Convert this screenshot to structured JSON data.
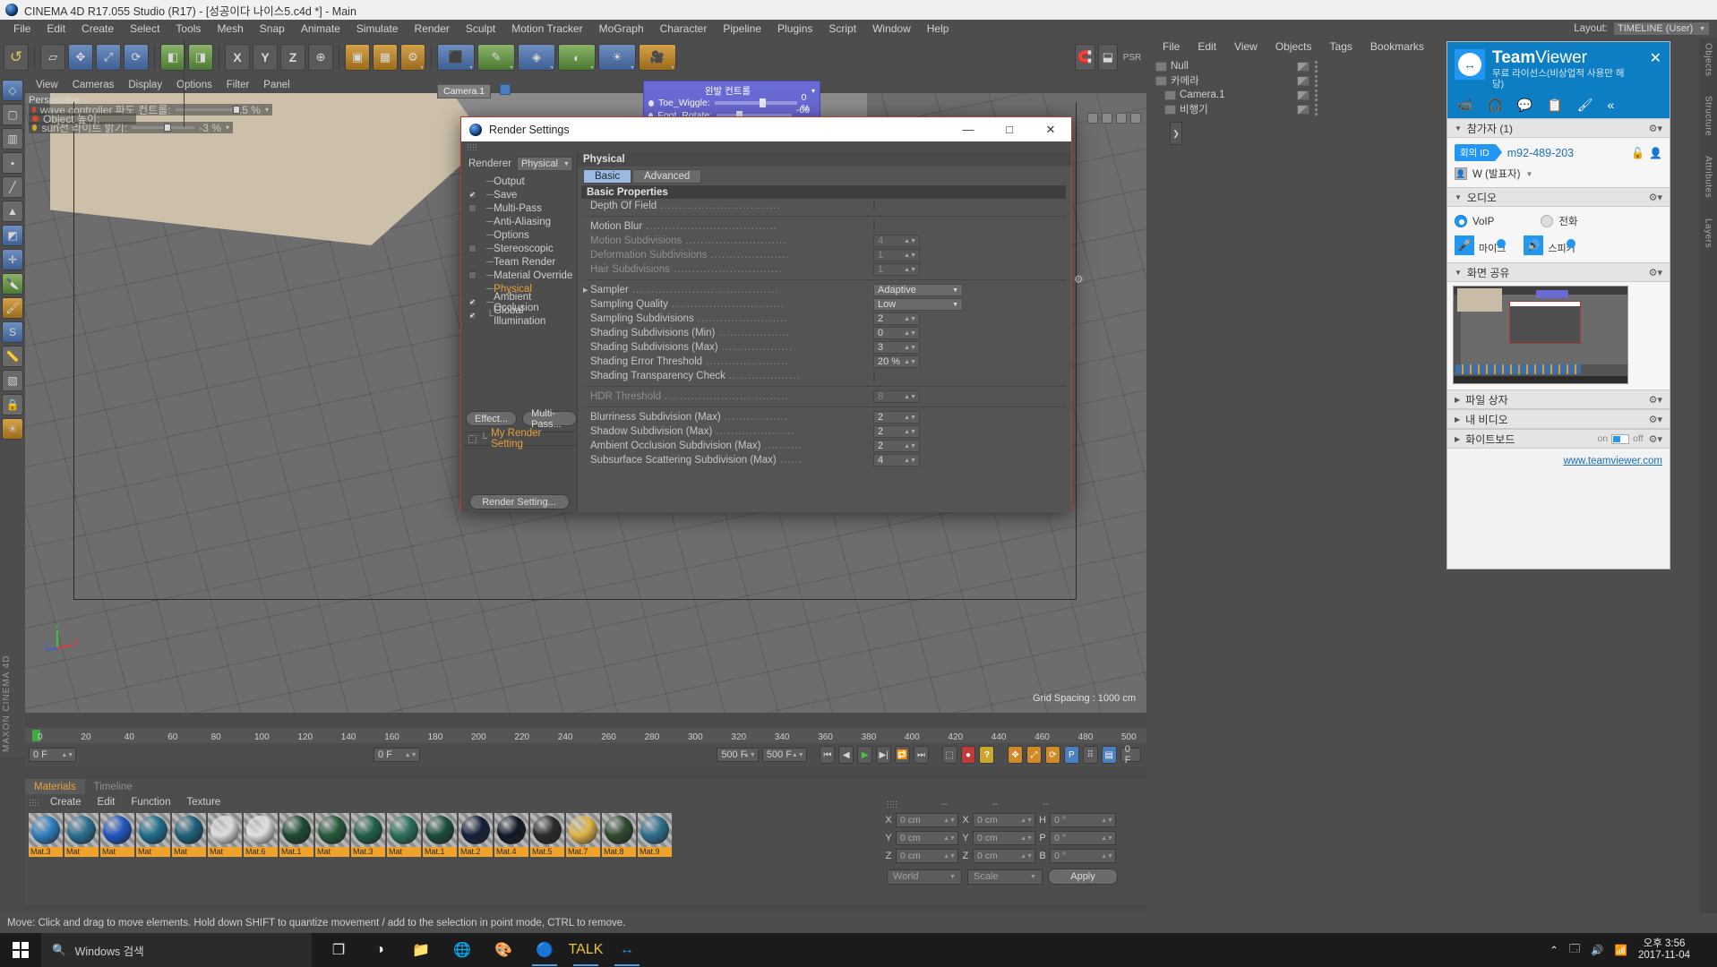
{
  "titlebar": {
    "text": "CINEMA 4D R17.055 Studio (R17) - [성공이다 나이스5.c4d *] - Main"
  },
  "menubar": {
    "items": [
      "File",
      "Edit",
      "Create",
      "Select",
      "Tools",
      "Mesh",
      "Snap",
      "Animate",
      "Simulate",
      "Render",
      "Sculpt",
      "Motion Tracker",
      "MoGraph",
      "Character",
      "Pipeline",
      "Plugins",
      "Script",
      "Window",
      "Help"
    ]
  },
  "layout": {
    "label": "Layout:",
    "value": "TIMELINE (User)"
  },
  "toolbar": {
    "buttons": [
      "undo",
      "redo",
      "select",
      "move",
      "scale",
      "rotate",
      "X",
      "Y",
      "Z",
      "world",
      "render-view",
      "render-region",
      "render-settings",
      "cube",
      "spline",
      "generator",
      "deformer",
      "scene",
      "light",
      "camera"
    ]
  },
  "viewport": {
    "menu": [
      "View",
      "Cameras",
      "Display",
      "Options",
      "Filter",
      "Panel"
    ],
    "label": "Perspective",
    "grid_spacing": "Grid Spacing : 1000 cm",
    "camera_tag": "Camera.1",
    "hud": [
      {
        "dot": "#d64a2a",
        "text": "wave controller 파도 컨트롤:",
        "value": "15 %"
      },
      {
        "dot": "#d6a62a",
        "text": "sun전 라이트 밝기:",
        "value": "-3 %"
      },
      {
        "dot": "#d64a2a",
        "text": "Object 높이:",
        "value": ""
      }
    ],
    "blue_panel": [
      {
        "label": "왼발 컨트롤",
        "value": ""
      },
      {
        "label": "Toe_Wiggle:",
        "value": "0 %"
      },
      {
        "label": "Foot_Rotate:",
        "value": "-66 %"
      }
    ]
  },
  "render_settings": {
    "title": "Render Settings",
    "window_controls": {
      "minimize": "—",
      "maximize": "□",
      "close": "✕"
    },
    "renderer_label": "Renderer",
    "renderer_value": "Physical",
    "tree": [
      {
        "label": "Output",
        "check": "none",
        "selected": false
      },
      {
        "label": "Save",
        "check": "checked",
        "selected": false
      },
      {
        "label": "Multi-Pass",
        "check": "empty",
        "selected": false
      },
      {
        "label": "Anti-Aliasing",
        "check": "none",
        "selected": false
      },
      {
        "label": "Options",
        "check": "none",
        "selected": false
      },
      {
        "label": "Stereoscopic",
        "check": "empty",
        "selected": false
      },
      {
        "label": "Team Render",
        "check": "none",
        "selected": false
      },
      {
        "label": "Material Override",
        "check": "empty",
        "selected": false
      },
      {
        "label": "Physical",
        "check": "none",
        "selected": true
      },
      {
        "label": "Ambient Occlusion",
        "check": "checked",
        "selected": false
      },
      {
        "label": "Global Illumination",
        "check": "checked",
        "selected": false
      }
    ],
    "effect_button": "Effect...",
    "multipass_button": "Multi-Pass...",
    "my_render_setting": "My Render Setting",
    "render_setting_button": "Render Setting...",
    "panel_title": "Physical",
    "tabs": [
      {
        "label": "Basic",
        "active": true
      },
      {
        "label": "Advanced",
        "active": false
      }
    ],
    "group_title": "Basic Properties",
    "rows": [
      {
        "label": "Depth Of Field",
        "type": "check",
        "value": "",
        "dim": false,
        "arrow": false
      },
      {
        "label": "Motion Blur",
        "type": "check",
        "value": "",
        "dim": false,
        "arrow": false
      },
      {
        "label": "Motion Subdivisions",
        "type": "num",
        "value": "4",
        "dim": true,
        "arrow": false
      },
      {
        "label": "Deformation Subdivisions",
        "type": "num",
        "value": "1",
        "dim": true,
        "arrow": false
      },
      {
        "label": "Hair Subdivisions",
        "type": "num",
        "value": "1",
        "dim": true,
        "arrow": false
      },
      {
        "label": "Sampler",
        "type": "select",
        "value": "Adaptive",
        "dim": false,
        "arrow": true
      },
      {
        "label": "Sampling Quality",
        "type": "select",
        "value": "Low",
        "dim": false,
        "arrow": false
      },
      {
        "label": "Sampling Subdivisions",
        "type": "num",
        "value": "2",
        "dim": false,
        "arrow": false
      },
      {
        "label": "Shading Subdivisions (Min)",
        "type": "num",
        "value": "0",
        "dim": false,
        "arrow": false
      },
      {
        "label": "Shading Subdivisions (Max)",
        "type": "num",
        "value": "3",
        "dim": false,
        "arrow": false
      },
      {
        "label": "Shading Error Threshold",
        "type": "num",
        "value": "20 %",
        "dim": false,
        "arrow": false
      },
      {
        "label": "Shading Transparency Check",
        "type": "check",
        "value": "",
        "dim": false,
        "arrow": false
      },
      {
        "label": "HDR Threshold",
        "type": "num",
        "value": "8",
        "dim": true,
        "arrow": false
      },
      {
        "label": "Blurriness Subdivision (Max)",
        "type": "num",
        "value": "2",
        "dim": false,
        "arrow": false
      },
      {
        "label": "Shadow Subdivision (Max)",
        "type": "num",
        "value": "2",
        "dim": false,
        "arrow": false
      },
      {
        "label": "Ambient Occlusion Subdivision (Max)",
        "type": "num",
        "value": "2",
        "dim": false,
        "arrow": false
      },
      {
        "label": "Subsurface Scattering Subdivision (Max)",
        "type": "num",
        "value": "4",
        "dim": false,
        "arrow": false
      }
    ]
  },
  "object_manager": {
    "menu": [
      "File",
      "Edit",
      "View",
      "Objects",
      "Tags",
      "Bookmarks"
    ],
    "rows": [
      {
        "label": "Null",
        "icon": "null-icon"
      },
      {
        "label": "카메라",
        "icon": "camera-icon"
      },
      {
        "label": "Camera.1",
        "icon": "camera-icon"
      },
      {
        "label": "비행기",
        "icon": "object-icon"
      }
    ]
  },
  "dock_tabs": [
    "Objects",
    "Structure",
    "Attributes",
    "Layers"
  ],
  "timeline": {
    "ticks": [
      "0",
      "20",
      "40",
      "60",
      "80",
      "100",
      "120",
      "140",
      "160",
      "180",
      "200",
      "220",
      "240",
      "260",
      "280",
      "300",
      "320",
      "340",
      "360",
      "380",
      "400",
      "420",
      "440",
      "460",
      "480",
      "500"
    ],
    "current_frame": "0 F",
    "start_frame": "0 F",
    "end_frame": "500 F",
    "preview_end": "500 F",
    "right_frame": "0 F"
  },
  "materials": {
    "tabs": [
      {
        "label": "Materials",
        "active": true
      },
      {
        "label": "Timeline",
        "active": false
      }
    ],
    "menu": [
      "Create",
      "Edit",
      "Function",
      "Texture"
    ],
    "items": [
      {
        "name": "Mat.3",
        "color": "#2f7fc0"
      },
      {
        "name": "Mat",
        "color": "#2a6f8f"
      },
      {
        "name": "Mat",
        "color": "#2255c0"
      },
      {
        "name": "Mat",
        "color": "#1e6e8c"
      },
      {
        "name": "Mat",
        "color": "#1f5f7a"
      },
      {
        "name": "Mat",
        "color": "#dcdcdc"
      },
      {
        "name": "Mat.6",
        "color": "#e0e0e0"
      },
      {
        "name": "Mat.1",
        "color": "#1d4a33"
      },
      {
        "name": "Mat",
        "color": "#265a3c"
      },
      {
        "name": "Mat.3",
        "color": "#1f5f4a"
      },
      {
        "name": "Mat",
        "color": "#2a6f5c"
      },
      {
        "name": "Mat.1",
        "color": "#1a4e3c"
      },
      {
        "name": "Mat.2",
        "color": "#14213a"
      },
      {
        "name": "Mat.4",
        "color": "#101826"
      },
      {
        "name": "Mat.5",
        "color": "#2a2a2a"
      },
      {
        "name": "Mat.7",
        "color": "#e0b547"
      },
      {
        "name": "Mat.8",
        "color": "#2f4a2f"
      },
      {
        "name": "Mat.9",
        "color": "#2f6f8f"
      }
    ]
  },
  "coordinates": {
    "headers": [
      "--",
      "--",
      "--"
    ],
    "rows": [
      {
        "l1": "X",
        "v1": "0 cm",
        "l2": "X",
        "v2": "0 cm",
        "l3": "H",
        "v3": "0 °"
      },
      {
        "l1": "Y",
        "v1": "0 cm",
        "l2": "Y",
        "v2": "0 cm",
        "l3": "P",
        "v3": "0 °"
      },
      {
        "l1": "Z",
        "v1": "0 cm",
        "l2": "Z",
        "v2": "0 cm",
        "l3": "B",
        "v3": "0 °"
      }
    ],
    "world": "World",
    "scale": "Scale",
    "apply": "Apply"
  },
  "statusbar": {
    "text": "Move: Click and drag to move elements. Hold down SHIFT to quantize movement / add to the selection in point mode, CTRL to remove."
  },
  "teamviewer": {
    "brand_bold": "Team",
    "brand_light": "Viewer",
    "license": "무료 라이선스(비상업적 사용만 해당)",
    "close": "✕",
    "toolbar_icons": [
      "video-icon",
      "headset-icon",
      "chat-icon",
      "notes-icon",
      "brush-icon",
      "collapse-icon"
    ],
    "participants": {
      "title": "참가자 (1)"
    },
    "meeting_id_label": "회의 ID",
    "meeting_id_value": "m92-489-203",
    "user": "W (발표자)",
    "audio": {
      "title": "오디오",
      "voip": "VoIP",
      "phone": "전화",
      "mic": "마이크",
      "speaker": "스피커"
    },
    "screen_share": {
      "title": "화면 공유"
    },
    "file_box": {
      "title": "파일 상자"
    },
    "my_video": {
      "title": "내 비디오"
    },
    "whiteboard": {
      "title": "화이트보드",
      "on": "on",
      "off": "off"
    },
    "link": "www.teamviewer.com"
  },
  "taskbar": {
    "search_placeholder": "Windows 검색",
    "apps": [
      "task-view-icon",
      "cortana-icon",
      "file-explorer-icon",
      "chrome-icon",
      "paint-icon",
      "cinema4d-icon",
      "talk-icon",
      "teamviewer-icon"
    ],
    "time": "오후 3:56",
    "date": "2017-11-04"
  }
}
